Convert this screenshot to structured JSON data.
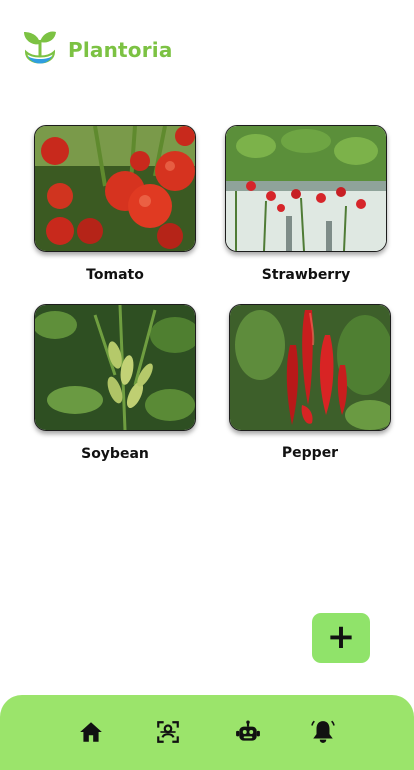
{
  "app": {
    "name": "Plantoria"
  },
  "plants": [
    {
      "label": "Tomato",
      "icon": "tomato-photo"
    },
    {
      "label": "Strawberry",
      "icon": "strawberry-photo"
    },
    {
      "label": "Soybean",
      "icon": "soybean-photo"
    },
    {
      "label": "Pepper",
      "icon": "pepper-photo"
    }
  ],
  "fab": {
    "label": "+"
  },
  "nav": [
    {
      "icon": "home-icon"
    },
    {
      "icon": "face-scan-icon"
    },
    {
      "icon": "robot-icon"
    },
    {
      "icon": "bell-icon"
    }
  ],
  "colors": {
    "brand": "#7cc243",
    "accent": "#9be46b",
    "fab": "#90e36a"
  }
}
